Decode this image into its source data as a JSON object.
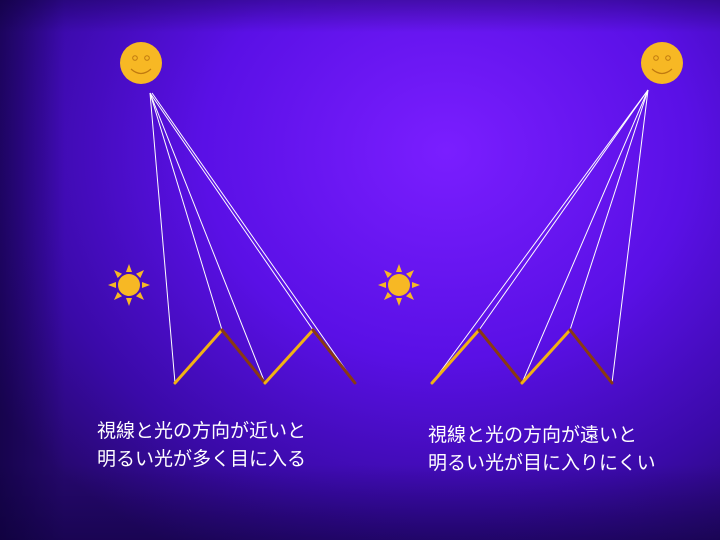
{
  "captions": {
    "left": {
      "line1": "視線と光の方向が近いと",
      "line2": "明るい光が多く目に入る"
    },
    "right": {
      "line1": "視線と光の方向が遠いと",
      "line2": "明るい光が目に入りにくい"
    }
  },
  "icons": [
    "moon-face-icon",
    "sun-icon"
  ],
  "colors": {
    "background": "#5a10e6",
    "sun": "#f7b824",
    "ray": "#ffffff",
    "lit_facet": "#f2b213",
    "shaded_facet": "#8a3a12"
  }
}
